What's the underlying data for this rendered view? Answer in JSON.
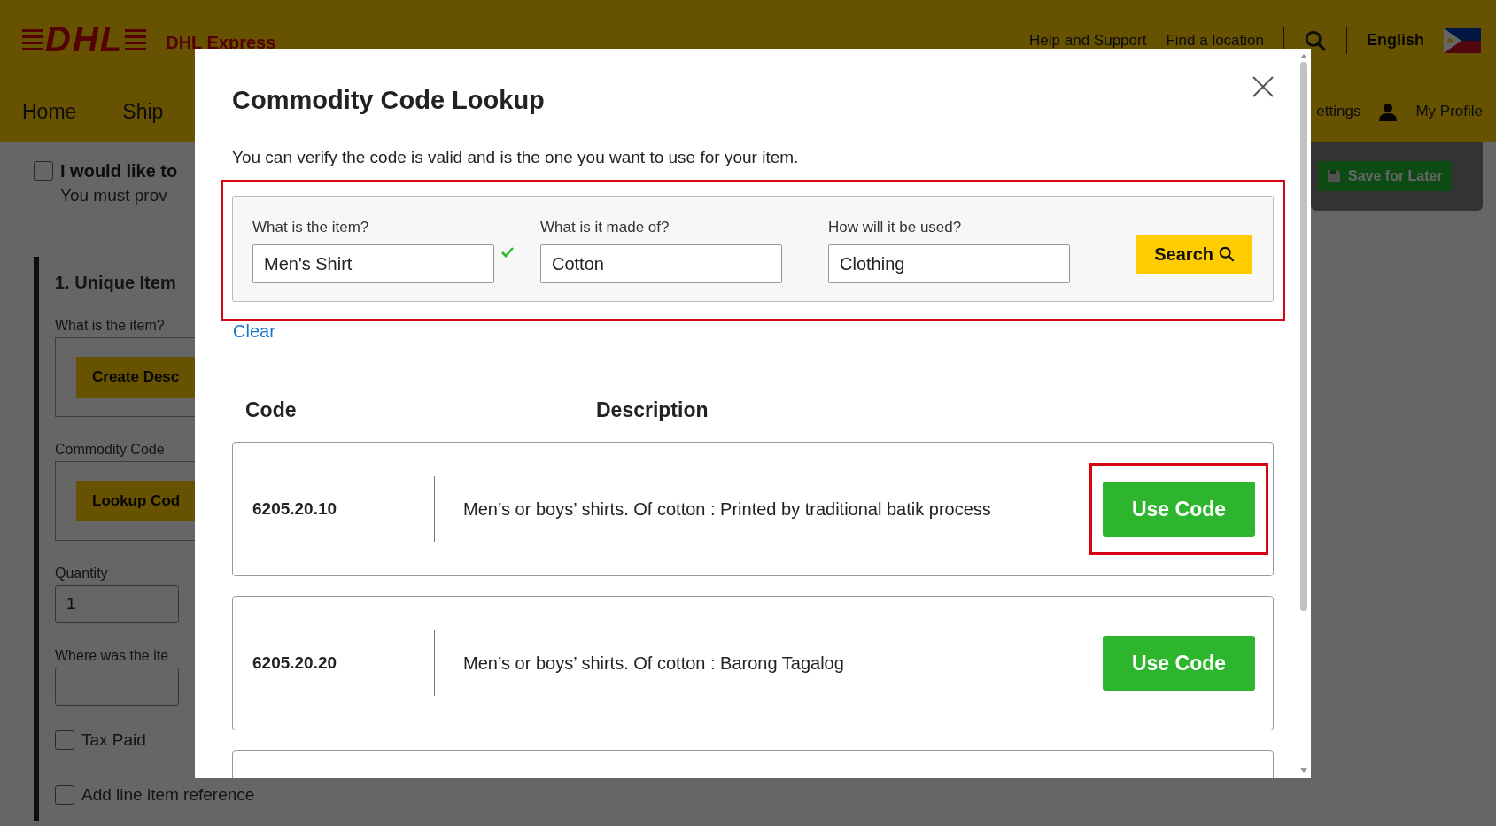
{
  "header": {
    "logo": "DHL",
    "brand": "DHL Express",
    "links": [
      "Help and Support",
      "Find a location"
    ],
    "language": "English"
  },
  "nav": {
    "items": [
      "Home",
      "Ship"
    ],
    "right_items": [
      "ettings",
      "My Profile"
    ]
  },
  "page": {
    "consent": {
      "label": "I would like to",
      "note": "You must prov",
      "checked": false
    },
    "section_title": "1. Unique Item",
    "fields": [
      {
        "kind": "button",
        "label": "What is the item?",
        "button": "Create Desc"
      },
      {
        "kind": "button",
        "label": "Commodity Code",
        "button": "Lookup Cod"
      },
      {
        "kind": "input",
        "label": "Quantity",
        "value": "1"
      },
      {
        "kind": "input",
        "label": "Where was the ite"
      }
    ],
    "checkboxes": [
      {
        "label": "Tax Paid",
        "checked": false
      },
      {
        "label": "Add line item reference",
        "checked": false
      }
    ],
    "save_button": "Save for Later"
  },
  "modal": {
    "title": "Commodity Code Lookup",
    "intro": "You can verify the code is valid and is the one you want to use for your item.",
    "search_panel": {
      "highlighted": true,
      "fields": [
        {
          "label": "What is the item?",
          "value": "Men's Shirt",
          "valid": true
        },
        {
          "label": "What is it made of?",
          "value": "Cotton",
          "valid": false
        },
        {
          "label": "How will it be used?",
          "value": "Clothing",
          "valid": false
        }
      ],
      "button": "Search"
    },
    "clear_link": "Clear",
    "columns": [
      "Code",
      "Description"
    ],
    "results": [
      {
        "code": "6205.20.10",
        "description": "Men’s or boys’ shirts. Of cotton : Printed by traditional batik process",
        "button": "Use Code",
        "highlighted": true
      },
      {
        "code": "6205.20.20",
        "description": "Men’s or boys’ shirts. Of cotton : Barong Tagalog",
        "button": "Use Code",
        "highlighted": false
      }
    ]
  }
}
